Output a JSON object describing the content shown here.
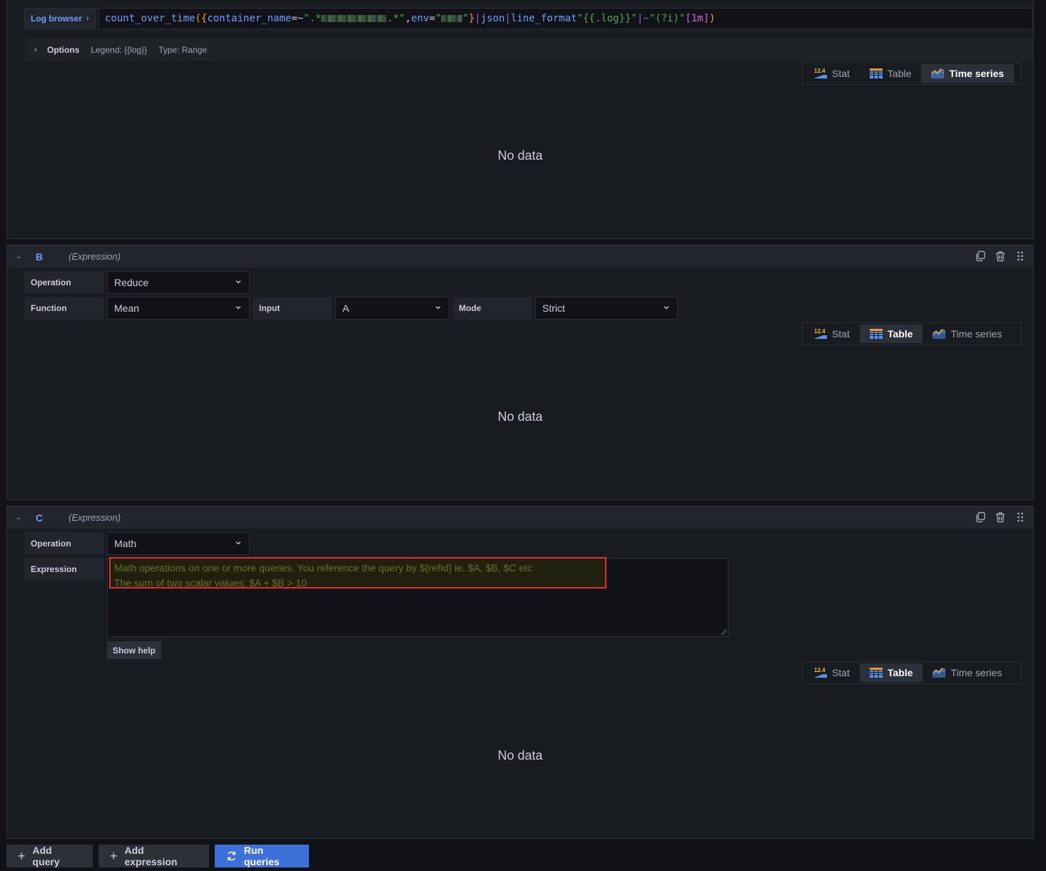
{
  "query_a": {
    "log_browser_label": "Log browser",
    "expr": {
      "fn": "count_over_time",
      "open_paren": "(",
      "open_brace": "{",
      "label1": "container_name",
      "op1": "=~",
      "str1_start": "\".*",
      "str1_end": ".*\"",
      "comma": ", ",
      "label2": "env",
      "op2": "=",
      "str2_start": "\"",
      "str2_end": "\"",
      "close_brace": "}",
      "pipe1": " | ",
      "json_kw": "json",
      "pipe2": " | ",
      "line_format_kw": "line_format",
      "line_format_str": " \"{{.log}}\"",
      "regex_op": " |~ ",
      "regex_str": "\"(?i)\"",
      "range": "[1m]",
      "close_paren": ")"
    },
    "options": {
      "title": "Options",
      "legend": "Legend: {{log}}",
      "type": "Type: Range"
    },
    "no_data": "No data"
  },
  "view_toggle": {
    "stat": "Stat",
    "table": "Table",
    "time_series": "Time series",
    "stat_icon_text": "12.4"
  },
  "query_b": {
    "refid": "B",
    "type": "(Expression)",
    "operation_label": "Operation",
    "operation_value": "Reduce",
    "function_label": "Function",
    "function_value": "Mean",
    "input_label": "Input",
    "input_value": "A",
    "mode_label": "Mode",
    "mode_value": "Strict",
    "no_data": "No data"
  },
  "query_c": {
    "refid": "C",
    "type": "(Expression)",
    "operation_label": "Operation",
    "operation_value": "Math",
    "expression_label": "Expression",
    "placeholder_line1": "Math operations on one or more queries. You reference the query by ${refId} ie. $A, $B, $C etc",
    "placeholder_line2": "The sum of two scalar values: $A + $B > 10",
    "show_help": "Show help",
    "no_data": "No data"
  },
  "footer": {
    "add_query": "Add query",
    "add_expression": "Add expression",
    "run_queries": "Run queries"
  }
}
